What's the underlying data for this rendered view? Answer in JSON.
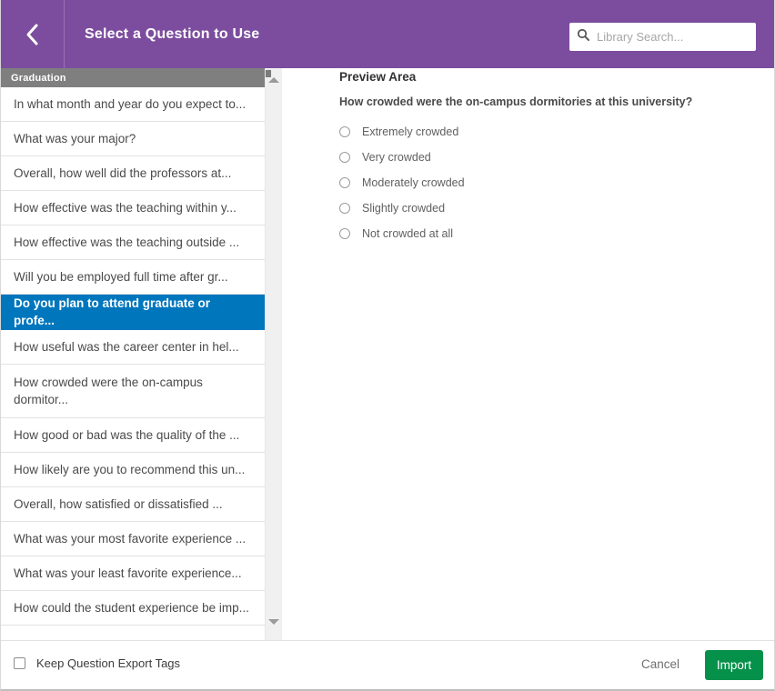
{
  "header": {
    "title": "Select a Question to Use",
    "back_icon": "chevron-left-icon",
    "search": {
      "icon": "search-icon",
      "placeholder": "Library Search...",
      "value": ""
    },
    "background_color": "#7c4d9e"
  },
  "list": {
    "category": "Graduation",
    "selected_index": 6,
    "items": [
      {
        "label": "In what month and year do you expect to...",
        "tall": false
      },
      {
        "label": "What was your major?",
        "tall": false
      },
      {
        "label": "Overall, how well did the professors at...",
        "tall": false
      },
      {
        "label": "How effective was the teaching within y...",
        "tall": false
      },
      {
        "label": "How effective was the teaching outside ...",
        "tall": false
      },
      {
        "label": "Will you be employed full time after gr...",
        "tall": false
      },
      {
        "label": "Do you plan to attend graduate or profe...",
        "tall": false
      },
      {
        "label": "How useful was the career center in hel...",
        "tall": false
      },
      {
        "label": "How crowded were the on-campus dormitor...",
        "tall": true
      },
      {
        "label": "How good or bad was the quality of the ...",
        "tall": false
      },
      {
        "label": "How likely are you to recommend this un...",
        "tall": false
      },
      {
        "label": "Overall, how satisfied or dissatisfied ...",
        "tall": false
      },
      {
        "label": "What was your most favorite experience ...",
        "tall": false
      },
      {
        "label": "What was your least favorite experience...",
        "tall": false
      },
      {
        "label": "How could the student experience be imp...",
        "tall": false
      }
    ],
    "selected_color": "#0076bd",
    "category_color": "#7f7f7f"
  },
  "scrollbar": {
    "up_icon": "scroll-up-arrow-icon",
    "down_icon": "scroll-down-arrow-icon"
  },
  "preview": {
    "title": "Preview Area",
    "question": "How crowded were the on-campus dormitories at this university?",
    "choices": [
      "Extremely crowded",
      "Very crowded",
      "Moderately crowded",
      "Slightly crowded",
      "Not crowded at all"
    ]
  },
  "footer": {
    "keep_tags_label": "Keep Question Export Tags",
    "keep_tags_checked": false,
    "cancel_label": "Cancel",
    "import_label": "Import",
    "import_color": "#06914b"
  }
}
